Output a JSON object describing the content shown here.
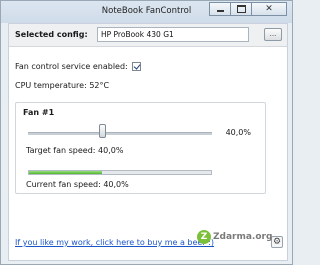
{
  "window": {
    "title": "NoteBook FanControl"
  },
  "config": {
    "label": "Selected config:",
    "value": "HP ProBook 430 G1",
    "browse_label": "..."
  },
  "service": {
    "label": "Fan control service enabled:",
    "enabled": true
  },
  "cpu": {
    "label": "CPU temperature:  52°C"
  },
  "fan": {
    "title": "Fan #1",
    "slider_value": "40,0%",
    "slider_fraction": 0.4,
    "target_label": "Target fan speed:  40,0%",
    "current_label": "Current fan speed:  40,0%",
    "current_fraction": 0.4
  },
  "footer": {
    "donate_text": "If you like my work, click here to buy me a beer :)",
    "watermark_text": "Zdarma.org",
    "watermark_glyph": "Z"
  },
  "colors": {
    "link": "#1a55c8",
    "progress": "#4fb52f",
    "watermark": "#7cbf3a"
  },
  "icons": {
    "minimize": "minimize-icon",
    "maximize": "maximize-icon",
    "close": "close-icon",
    "settings": "gear-icon",
    "checkbox": "check-icon"
  }
}
